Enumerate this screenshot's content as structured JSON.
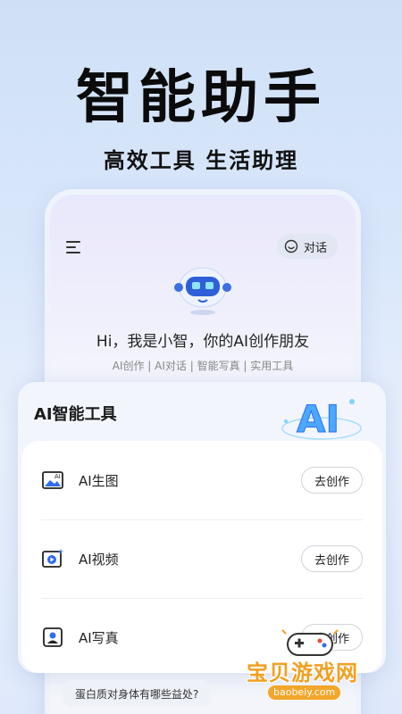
{
  "hero": {
    "title": "智能助手",
    "subtitle": "高效工具 生活助理"
  },
  "app": {
    "chat_button": "对话",
    "greeting": "Hi，我是小智，你的AI创作朋友",
    "tags": "AI创作 | AI对话 | 智能写真 | 实用工具"
  },
  "tools": {
    "title": "AI智能工具",
    "logo_text": "AI",
    "items": [
      {
        "label": "AI生图",
        "action": "去创作",
        "icon": "image-gen-icon"
      },
      {
        "label": "AI视频",
        "action": "去创作",
        "icon": "video-icon"
      },
      {
        "label": "AI写真",
        "action": "去创作",
        "icon": "portrait-icon"
      }
    ]
  },
  "suggestion": "蛋白质对身体有哪些益处?",
  "watermark": {
    "main": "宝贝游戏网",
    "url": "baobeiy.com"
  },
  "colors": {
    "accent": "#2f6df0",
    "watermark": "#f0a020"
  }
}
